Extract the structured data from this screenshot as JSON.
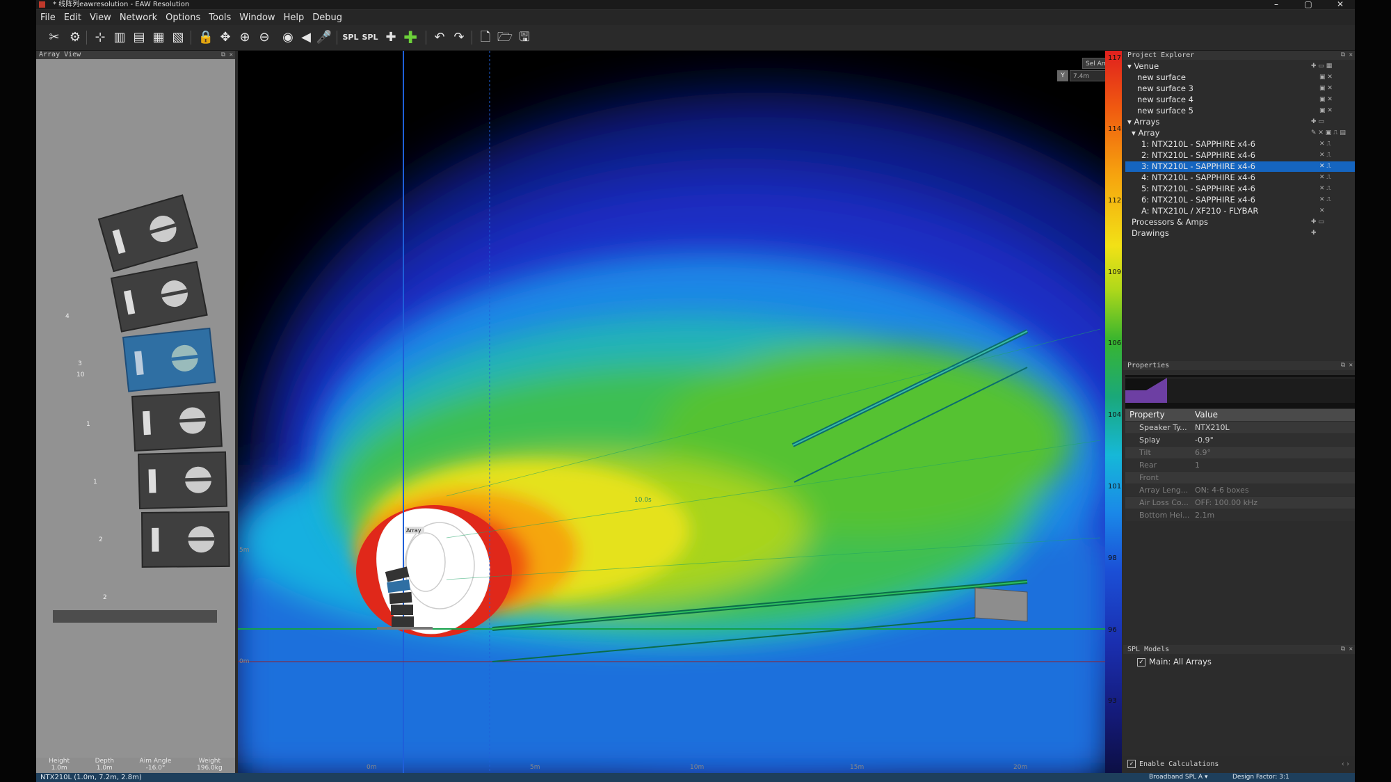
{
  "window": {
    "title": "* 线阵列eawresolution - EAW Resolution",
    "minimize": "–",
    "maximize": "▢",
    "close": "✕"
  },
  "menu": [
    "File",
    "Edit",
    "View",
    "Network",
    "Options",
    "Tools",
    "Window",
    "Help",
    "Debug"
  ],
  "toolbar": {
    "spl_label": "SPL",
    "spl2_label": "SPL"
  },
  "array_view": {
    "title": "Array View",
    "box_numbers": [
      "4",
      "3",
      "10",
      "1",
      "1",
      "2",
      "2"
    ],
    "footer": [
      {
        "label": "Height",
        "value": "1.0m"
      },
      {
        "label": "Depth",
        "value": "1.0m"
      },
      {
        "label": "Aim Angle",
        "value": "-16.0°"
      },
      {
        "label": "Weight",
        "value": "196.0kg"
      }
    ]
  },
  "plot": {
    "sel_array_label": "Sel Array",
    "y_value": "7.4m",
    "y_key": "Y",
    "array_tag": "Array",
    "distance_labels": [
      "0m",
      "5m",
      "10m",
      "15m",
      "20m"
    ],
    "height_labels": [
      "0m",
      "5m"
    ],
    "axis_note": "10.0s"
  },
  "scale": {
    "values": [
      "117",
      "114",
      "112",
      "109",
      "106",
      "104",
      "101",
      "98",
      "96",
      "93"
    ]
  },
  "project_explorer": {
    "title": "Project Explorer",
    "venue": "Venue",
    "surfaces": [
      "new surface",
      "new surface 3",
      "new surface 4",
      "new surface 5"
    ],
    "arrays": "Arrays",
    "array": "Array",
    "boxes": [
      "1: NTX210L - SAPPHIRE x4-6",
      "2: NTX210L - SAPPHIRE x4-6",
      "3: NTX210L - SAPPHIRE x4-6",
      "4: NTX210L - SAPPHIRE x4-6",
      "5: NTX210L - SAPPHIRE x4-6",
      "6: NTX210L - SAPPHIRE x4-6",
      "A: NTX210L / XF210 - FLYBAR"
    ],
    "selected_index": 2,
    "processors": "Processors & Amps",
    "drawings": "Drawings"
  },
  "properties": {
    "title": "Properties",
    "col_property": "Property",
    "col_value": "Value",
    "rows": [
      {
        "key": "Speaker Ty...",
        "value": "NTX210L",
        "dim": false
      },
      {
        "key": "Splay",
        "value": "-0.9°",
        "dim": false
      },
      {
        "key": "Tilt",
        "value": "6.9°",
        "dim": true
      },
      {
        "key": "Rear",
        "value": "1",
        "dim": true
      },
      {
        "key": "Front",
        "value": "",
        "dim": true
      },
      {
        "key": "Array Leng...",
        "value": "ON: 4-6 boxes",
        "dim": true
      },
      {
        "key": "Air Loss Co...",
        "value": "OFF: 100.00 kHz",
        "dim": true
      },
      {
        "key": "Bottom Hei...",
        "value": "2.1m",
        "dim": true
      }
    ]
  },
  "spl_models": {
    "title": "SPL Models",
    "item": "Main: All Arrays",
    "checked": true
  },
  "bottom": {
    "enable_calc": "Enable Calculations",
    "broadband": "Broadband SPL A",
    "design_factor": "Design Factor: 3:1"
  },
  "status": {
    "text": "NTX210L (1.0m, 7.2m, 2.8m)"
  },
  "colors": {
    "selection": "#1565c0",
    "status_bar": "#1e3f5c",
    "selected_box": "#2f6fa3"
  }
}
